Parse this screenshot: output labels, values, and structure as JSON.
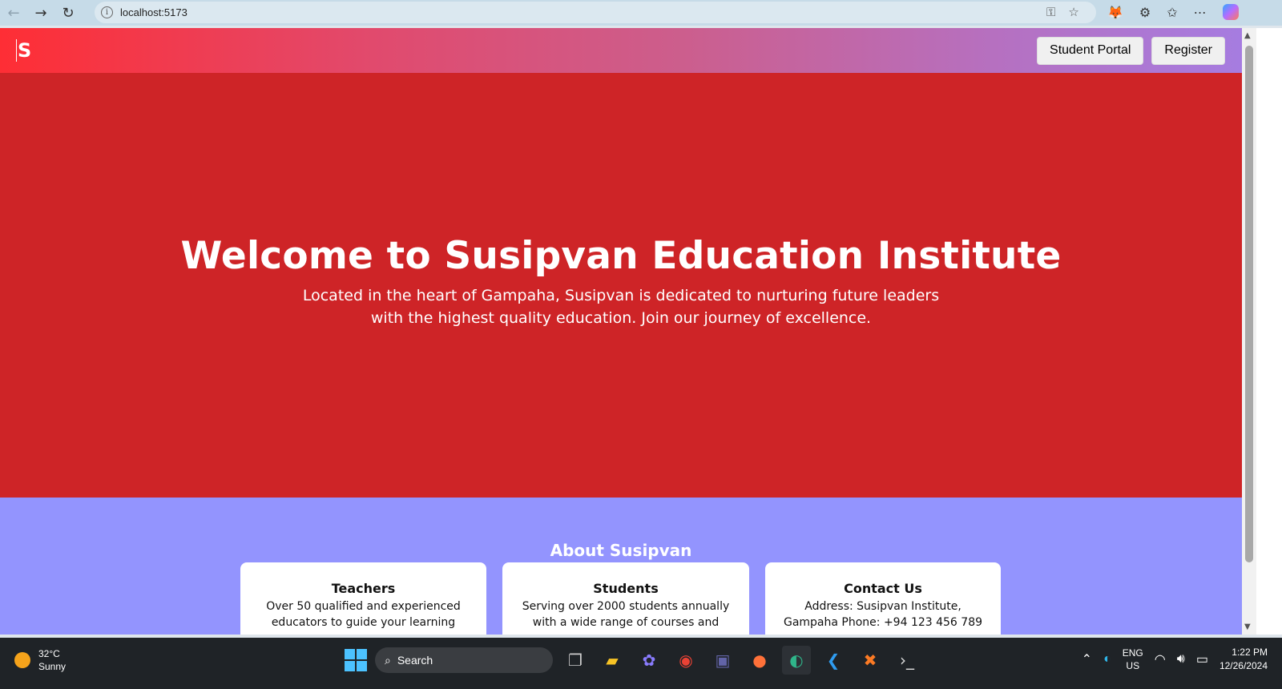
{
  "browser": {
    "url": "localhost:5173",
    "back_icon": "back-arrow-icon",
    "forward_icon": "forward-arrow-icon",
    "refresh_icon": "refresh-icon"
  },
  "site": {
    "logo": "S",
    "nav": {
      "student_portal": "Student Portal",
      "register": "Register"
    },
    "hero": {
      "title": "Welcome to Susipvan Education Institute",
      "text": "Located in the heart of Gampaha, Susipvan is dedicated to nurturing future leaders with the highest quality education. Join our journey of excellence."
    },
    "about": {
      "title": "About Susipvan",
      "cards": [
        {
          "title": "Teachers",
          "text": "Over 50 qualified and experienced educators to guide your learning"
        },
        {
          "title": "Students",
          "text": "Serving over 2000 students annually with a wide range of courses and"
        },
        {
          "title": "Contact Us",
          "text": "Address: Susipvan Institute, Gampaha Phone: +94 123 456 789"
        }
      ]
    },
    "colors": {
      "hero": "#ce2427",
      "about": "#9394fe",
      "header_start": "#fe2e35",
      "header_end": "#a67ce0"
    }
  },
  "taskbar": {
    "weather_temp": "32°C",
    "weather_desc": "Sunny",
    "search_label": "Search",
    "lang_1": "ENG",
    "lang_2": "US",
    "time": "1:22 PM",
    "date": "12/26/2024"
  }
}
